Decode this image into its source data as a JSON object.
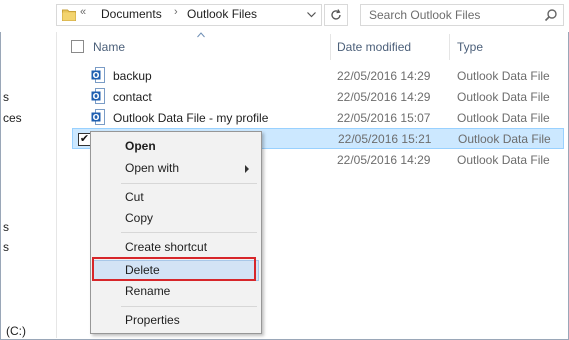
{
  "address_bar": {
    "overflow": "«",
    "crumbs": [
      "Documents",
      "Outlook Files"
    ]
  },
  "search": {
    "placeholder": "Search Outlook Files"
  },
  "nav_fragments": [
    "s",
    "ces",
    "s",
    "s",
    "(C:)"
  ],
  "columns": {
    "name": "Name",
    "date": "Date modified",
    "type": "Type"
  },
  "files": [
    {
      "name": "backup",
      "date": "22/05/2016 14:29",
      "type": "Outlook Data File",
      "icon": "outlook-data-file-icon"
    },
    {
      "name": "contact",
      "date": "22/05/2016 14:29",
      "type": "Outlook Data File",
      "icon": "outlook-data-file-icon"
    },
    {
      "name": "Outlook Data File - my profile",
      "date": "22/05/2016 15:07",
      "type": "Outlook Data File",
      "icon": "outlook-data-file-icon"
    },
    {
      "name": "",
      "date": "22/05/2016 15:21",
      "type": "Outlook Data File",
      "selected": true,
      "checked": true
    },
    {
      "name": "",
      "date": "22/05/2016 14:29",
      "type": "Outlook Data File"
    }
  ],
  "context_menu": {
    "open": "Open",
    "open_with": "Open with",
    "cut": "Cut",
    "copy": "Copy",
    "create_shortcut": "Create shortcut",
    "delete": "Delete",
    "rename": "Rename",
    "properties": "Properties"
  },
  "colors": {
    "selection_bg": "#cce8ff",
    "menu_highlight": "#d3e3f5",
    "annotation_red": "#d7262a",
    "header_text": "#4c607a"
  }
}
